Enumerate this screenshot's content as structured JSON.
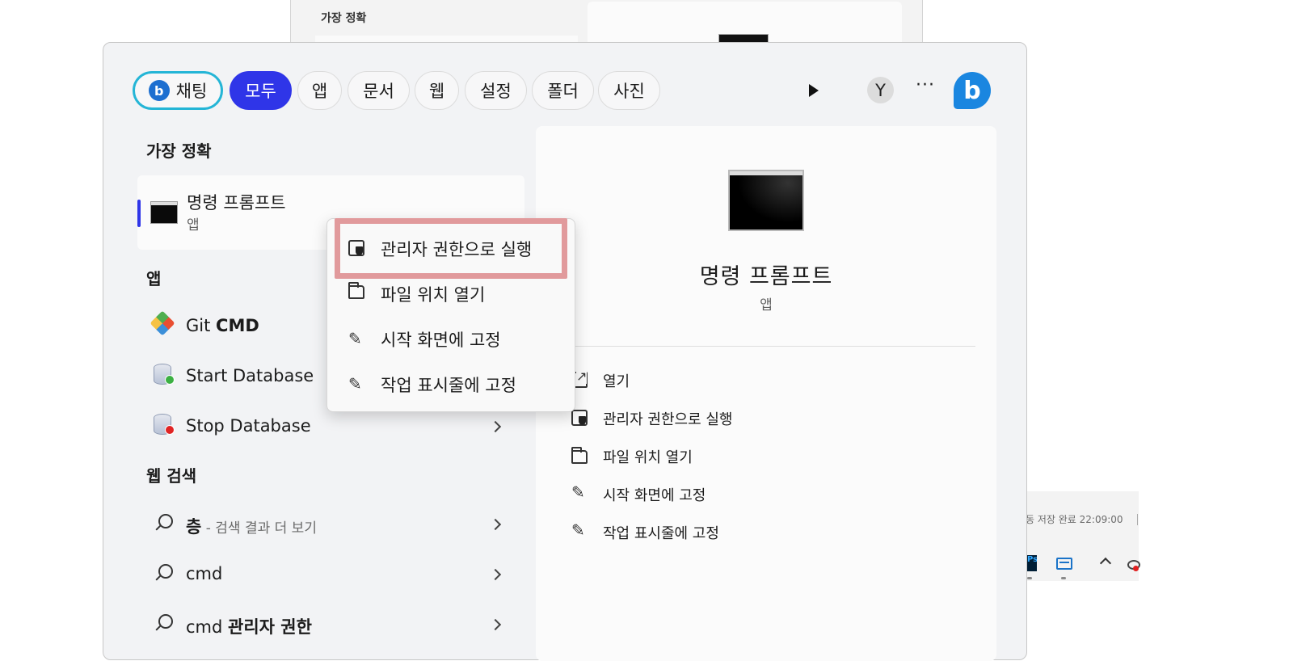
{
  "background_window": {
    "title": "가장 정확"
  },
  "taskbar": {
    "status_text": "동 저장 완료 22:09:00",
    "ps_label": "Ps"
  },
  "tabs": {
    "chat": "채팅",
    "items": [
      "모두",
      "앱",
      "문서",
      "웹",
      "설정",
      "폴더",
      "사진"
    ],
    "active": "모두",
    "avatar_initial": "Y",
    "more": "···",
    "bing_glyph": "b"
  },
  "best_match": {
    "section_title": "가장 정확",
    "name": "명령 프롬프트",
    "type": "앱"
  },
  "apps": {
    "section_title": "앱",
    "items": [
      {
        "prefix": "Git ",
        "bold": "CMD",
        "icon": "git-icon"
      },
      {
        "prefix": "Start Database",
        "bold": "",
        "icon": "database-start-icon"
      },
      {
        "prefix": "Stop Database",
        "bold": "",
        "icon": "database-stop-icon"
      }
    ]
  },
  "web_search": {
    "section_title": "웹 검색",
    "items": [
      {
        "bold": "층",
        "muted": " - 검색 결과 더 보기",
        "plain": ""
      },
      {
        "bold": "",
        "muted": "",
        "plain": "cmd"
      },
      {
        "bold": "관리자 권한",
        "muted": "",
        "plain": "cmd "
      }
    ]
  },
  "detail": {
    "name": "명령 프롬프트",
    "type": "앱",
    "actions": [
      {
        "label": "열기",
        "icon": "open-icon"
      },
      {
        "label": "관리자 권한으로 실행",
        "icon": "shield-icon"
      },
      {
        "label": "파일 위치 열기",
        "icon": "folder-icon"
      },
      {
        "label": "시작 화면에 고정",
        "icon": "pin-icon"
      },
      {
        "label": "작업 표시줄에 고정",
        "icon": "pin-icon"
      }
    ]
  },
  "context_menu": {
    "items": [
      {
        "label": "관리자 권한으로 실행",
        "icon": "shield-icon",
        "highlighted": true
      },
      {
        "label": "파일 위치 열기",
        "icon": "folder-icon",
        "highlighted": false
      },
      {
        "label": "시작 화면에 고정",
        "icon": "pin-icon",
        "highlighted": false
      },
      {
        "label": "작업 표시줄에 고정",
        "icon": "pin-icon",
        "highlighted": false
      }
    ]
  },
  "colors": {
    "accent": "#2f35e8",
    "chat_border": "#24b5d6",
    "highlight_border": "#e19a9c",
    "bing_blue": "#1a86e0"
  }
}
